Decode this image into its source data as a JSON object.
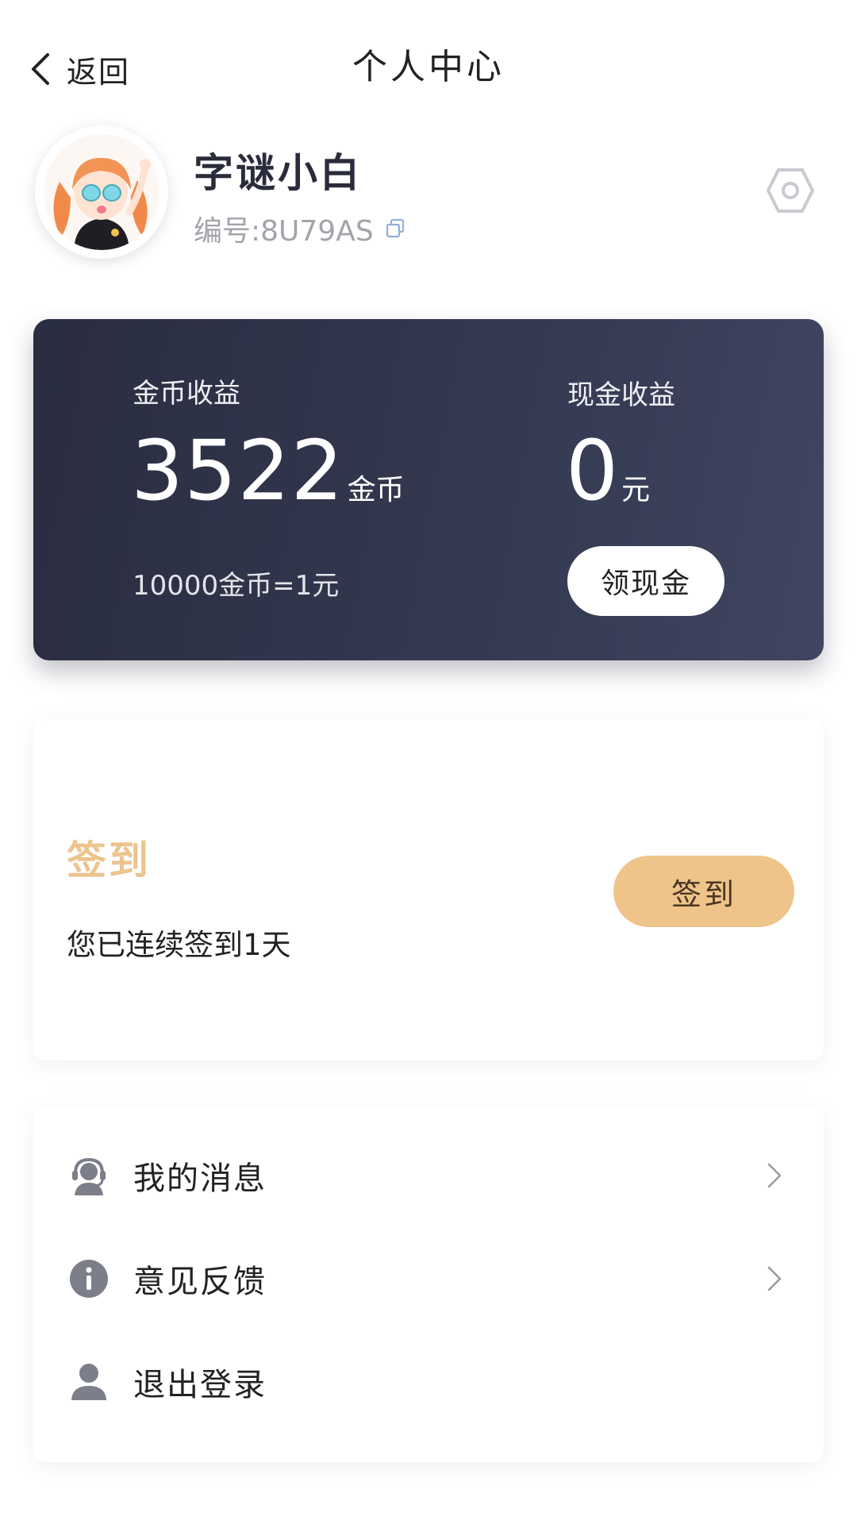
{
  "header": {
    "back_label": "返回",
    "title": "个人中心"
  },
  "profile": {
    "name": "字谜小白",
    "user_id": "编号:8U79AS"
  },
  "earnings": {
    "coin_label": "金币收益",
    "coin_value": "3522",
    "coin_unit": "金币",
    "rate_text": "10000金币=1元",
    "cash_label": "现金收益",
    "cash_value": "0",
    "cash_unit": "元",
    "withdraw_label": "领现金"
  },
  "signin": {
    "title": "签到",
    "streak_text": "您已连续签到1天",
    "button_label": "签到"
  },
  "menu": {
    "items": [
      {
        "label": "我的消息",
        "icon": "customer-service-icon",
        "has_chevron": true
      },
      {
        "label": "意见反馈",
        "icon": "info-icon",
        "has_chevron": true
      },
      {
        "label": "退出登录",
        "icon": "user-icon",
        "has_chevron": false
      }
    ]
  },
  "colors": {
    "card_dark": "#2a2d40",
    "signin_accent": "#ecc48e",
    "signin_button": "#eec48a",
    "icon_gray": "#7c7e89"
  }
}
